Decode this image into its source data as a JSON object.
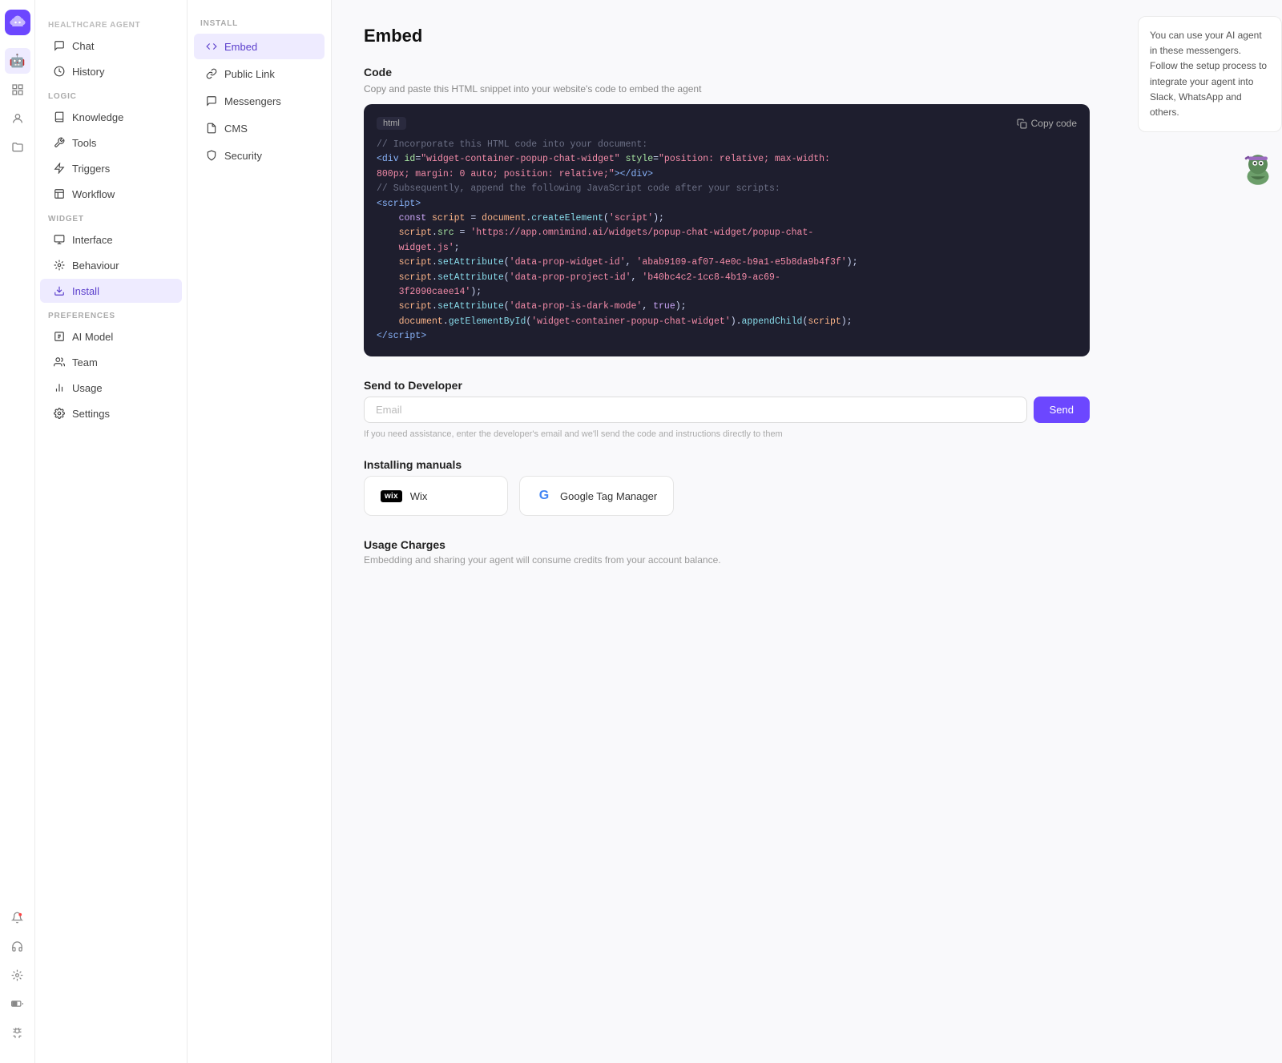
{
  "agent": {
    "label": "HEALTHCARE AGENT",
    "logo_icon": "brain"
  },
  "left_sidebar": {
    "section_main": "",
    "items": [
      {
        "id": "chat",
        "label": "Chat",
        "icon": "💬"
      },
      {
        "id": "history",
        "label": "History",
        "icon": "🕐"
      }
    ],
    "section_logic": "LOGIC",
    "logic_items": [
      {
        "id": "knowledge",
        "label": "Knowledge",
        "icon": "📚"
      },
      {
        "id": "tools",
        "label": "Tools",
        "icon": "🔧"
      },
      {
        "id": "triggers",
        "label": "Triggers",
        "icon": "⚡"
      },
      {
        "id": "workflow",
        "label": "Workflow",
        "icon": "📋"
      }
    ],
    "section_widget": "WIDGET",
    "widget_items": [
      {
        "id": "interface",
        "label": "Interface",
        "icon": "🖥"
      },
      {
        "id": "behaviour",
        "label": "Behaviour",
        "icon": "🎯"
      },
      {
        "id": "install",
        "label": "Install",
        "icon": "⬇"
      }
    ],
    "section_prefs": "PREFERENCES",
    "pref_items": [
      {
        "id": "ai-model",
        "label": "AI Model",
        "icon": "🤖"
      },
      {
        "id": "team",
        "label": "Team",
        "icon": "👥"
      },
      {
        "id": "usage",
        "label": "Usage",
        "icon": "📊"
      },
      {
        "id": "settings",
        "label": "Settings",
        "icon": "⚙"
      }
    ]
  },
  "install_sidebar": {
    "label": "INSTALL",
    "items": [
      {
        "id": "embed",
        "label": "Embed",
        "icon": "code"
      },
      {
        "id": "public-link",
        "label": "Public Link",
        "icon": "link"
      },
      {
        "id": "messengers",
        "label": "Messengers",
        "icon": "chat"
      },
      {
        "id": "cms",
        "label": "CMS",
        "icon": "cms"
      },
      {
        "id": "security",
        "label": "Security",
        "icon": "lock"
      }
    ]
  },
  "page": {
    "title": "Embed",
    "code_section": {
      "title": "Code",
      "description": "Copy and paste this HTML snippet into your website's code to embed the agent",
      "lang_badge": "html",
      "copy_button": "Copy code",
      "code_lines": [
        "// Incorporate this HTML code into your document:",
        "<div id=\"widget-container-popup-chat-widget\" style=\"position: relative; max-width:",
        "800px; margin: 0 auto; position: relative;\"></div>",
        "// Subsequently, append the following JavaScript code after your scripts:",
        "<script>",
        "    const script = document.createElement('script');",
        "    script.src = 'https://app.omnimind.ai/widgets/popup-chat-widget/popup-chat-",
        "widget.js';",
        "    script.setAttribute('data-prop-widget-id', 'abab9109-af07-4e0c-b9a1-e5b8da9b4f3f');",
        "    script.setAttribute('data-prop-project-id', 'b40bc4c2-1cc8-4b19-ac69-",
        "3f2090caee14');",
        "    script.setAttribute('data-prop-is-dark-mode', true);",
        "    document.getElementById('widget-container-popup-chat-widget').appendChild(script);",
        "<\\/script>"
      ]
    },
    "send_section": {
      "title": "Send to Developer",
      "email_placeholder": "Email",
      "send_button": "Send",
      "helper": "If you need assistance, enter the developer's email and we'll send the code and instructions directly to them"
    },
    "manuals_section": {
      "title": "Installing manuals",
      "items": [
        {
          "id": "wix",
          "badge": "wix",
          "label": "Wix"
        },
        {
          "id": "gtm",
          "badge": "G",
          "label": "Google Tag Manager"
        }
      ]
    },
    "usage_section": {
      "title": "Usage Charges",
      "description": "Embedding and sharing your agent will consume credits from your account balance."
    }
  },
  "info_panel": {
    "text": "You can use your AI agent in these messengers. Follow the setup process to integrate your agent into Slack, WhatsApp and others."
  },
  "rail_icons": [
    {
      "id": "brain",
      "icon": "🧠",
      "active": true
    },
    {
      "id": "bell",
      "icon": "🔔"
    },
    {
      "id": "person",
      "icon": "👤"
    },
    {
      "id": "folder",
      "icon": "📁"
    }
  ],
  "rail_bottom_icons": [
    {
      "id": "notification-bell",
      "icon": "🔔"
    },
    {
      "id": "headset",
      "icon": "🎧"
    },
    {
      "id": "settings2",
      "icon": "⚙"
    },
    {
      "id": "battery",
      "icon": "🔋"
    },
    {
      "id": "bug",
      "icon": "🐛"
    }
  ]
}
